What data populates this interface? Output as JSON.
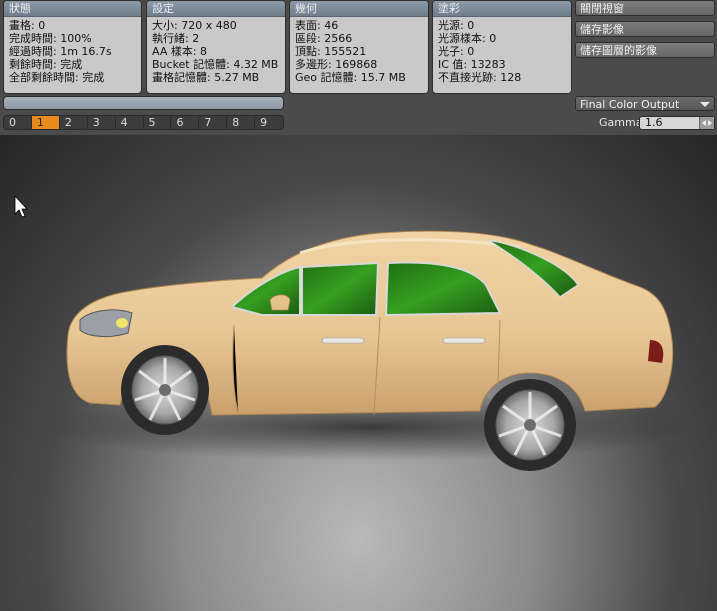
{
  "panels": {
    "status": {
      "title": "狀態",
      "lines": [
        "畫格: 0",
        "完成時間: 100%",
        "經過時間: 1m 16.7s",
        "剩餘時間: 完成",
        "全部剩餘時間: 完成"
      ]
    },
    "settings": {
      "title": "設定",
      "lines": [
        "大小: 720 x 480",
        "執行緒: 2",
        "AA 樣本: 8",
        "Bucket 記憶體: 4.32 MB",
        "畫格記憶體: 5.27 MB"
      ]
    },
    "geometry": {
      "title": "幾何",
      "lines": [
        "表面: 46",
        "區段: 2566",
        "頂點: 155521",
        "多邊形: 169868",
        "Geo 記憶體: 15.7 MB"
      ]
    },
    "shading": {
      "title": "塗彩",
      "lines": [
        "光源: 0",
        "光源樣本: 0",
        "光子: 0",
        "IC 值: 13283",
        "不直接光跡: 128"
      ]
    }
  },
  "actions": {
    "close_window": "關閉視窗",
    "save_image": "儲存影像",
    "save_layered_image": "儲存圖層的影像"
  },
  "frames": {
    "items": [
      "0",
      "1",
      "2",
      "3",
      "4",
      "5",
      "6",
      "7",
      "8",
      "9"
    ],
    "selected": "1"
  },
  "output": {
    "selected": "Final Color Output"
  },
  "gamma": {
    "label": "Gamma",
    "value": "1.6"
  },
  "render": {
    "subject": "car",
    "body_color": "#e8c795",
    "glass_color": "#35a020",
    "accent_color": "#e98a1c"
  }
}
